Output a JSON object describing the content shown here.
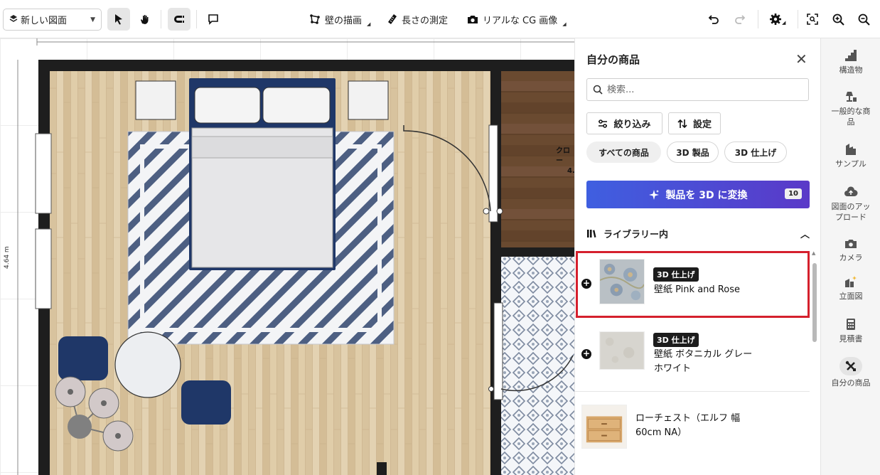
{
  "toolbar": {
    "plan_select_label": "新しい図面",
    "draw_walls": "壁の描画",
    "measure": "長さの測定",
    "render": "リアルな CG 画像"
  },
  "canvas": {
    "dimension_label": "4.64 m",
    "room_label_line1": "クロー",
    "room_label_line2": "4."
  },
  "panel": {
    "title": "自分の商品",
    "search_placeholder": "検索...",
    "filter_label": "絞り込み",
    "settings_label": "設定",
    "pills": [
      "すべての商品",
      "3D 製品",
      "3D 仕上げ"
    ],
    "convert_label": "製品を 3D に変換",
    "convert_count": "10",
    "section_title": "ライブラリー内",
    "items": [
      {
        "badge": "3D 仕上げ",
        "name": "壁紙 Pink and Rose"
      },
      {
        "badge": "3D 仕上げ",
        "name_line1": "壁紙 ボタニカル グレー",
        "name_line2": "ホワイト"
      },
      {
        "name_line1": "ローチェスト（エルフ 幅",
        "name_line2": "60cm NA）"
      }
    ]
  },
  "rail": {
    "items": [
      {
        "label": "構造物"
      },
      {
        "label_line1": "一般的な商",
        "label_line2": "品"
      },
      {
        "label": "サンプル"
      },
      {
        "label_line1": "図面のアッ",
        "label_line2": "プロード"
      },
      {
        "label": "カメラ"
      },
      {
        "label": "立面図"
      },
      {
        "label": "見積書"
      },
      {
        "label": "自分の商品"
      }
    ]
  },
  "colors": {
    "accent_start": "#3f5fe0",
    "accent_end": "#5a39c8",
    "highlight": "#d5202d",
    "floor_wood": "#dcc8a4",
    "dark_floor": "#6a4a30",
    "navy": "#1f3768"
  }
}
